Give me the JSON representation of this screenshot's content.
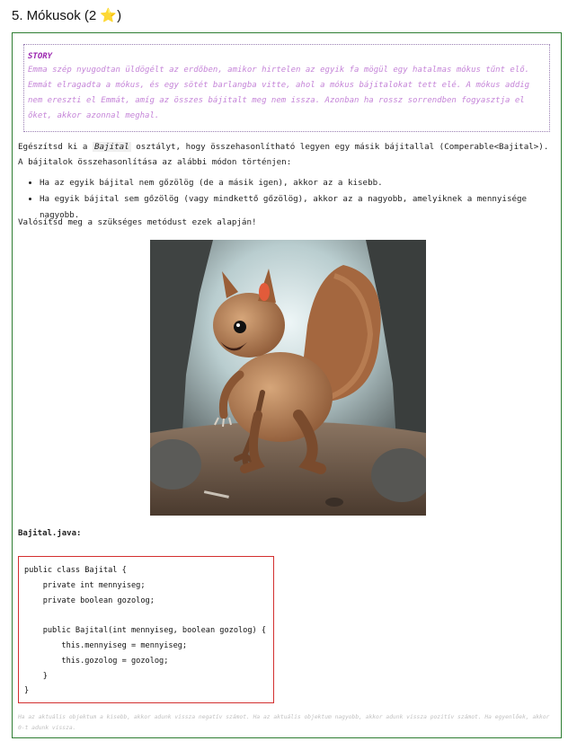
{
  "task": {
    "heading": "5. Mókusok (2 ",
    "star_icon": "⭐",
    "heading_close": ")"
  },
  "story": {
    "title": "STORY",
    "text": "Emma szép nyugodtan üldögélt az erdőben, amikor hirtelen az egyik fa mögül egy hatalmas mókus tűnt elő. Emmát elragadta a mókus, és egy sötét barlangba vitte, ahol a mókus bájitalokat tett elé. A mókus addig nem ereszti el Emmát, amíg az összes bájitalt meg nem issza. Azonban ha rossz sorrendben fogyasztja el őket, akkor azonnal meghal."
  },
  "instructions": {
    "intro_before": "Egészítsd ki a ",
    "class_name": "Bajital",
    "intro_after": " osztályt, hogy összehasonlítható legyen egy másik bájitallal (Comperable<Bajital>). A bájitalok összehasonlítása az alábbi módon történjen:",
    "rules": [
      "Ha az egyik bájital nem gőzölög (de a másik igen), akkor az a kisebb.",
      "Ha egyik bájital sem gőzölög (vagy mindkettő gőzölög), akkor az a nagyobb, amelyiknek a mennyisége nagyobb."
    ],
    "closing": "Valósítsd meg a szükséges metódust ezek alapján!"
  },
  "code": {
    "file_label": "Bajital.java:",
    "source": "public class Bajital {\n    private int mennyiseg;\n    private boolean gozolog;\n\n    public Bajital(int mennyiseg, boolean gozolog) {\n        this.mennyiseg = mennyiseg;\n        this.gozolog = gozolog;\n    }\n}"
  },
  "footnote": "Ha az aktuális objektum a kisebb, akkor adunk vissza negatív számot. Ha az aktuális objektum nagyobb, akkor adunk vissza pozitív számot. Ha egyenlőek, akkor 0-t adunk vissza.",
  "illustration": {
    "icon": "squirrel-in-cave-illustration"
  },
  "colors": {
    "card_border": "#2e7d32",
    "story_title": "#9c27b0",
    "story_text": "#c585d8",
    "code_border": "#d32f2f"
  }
}
